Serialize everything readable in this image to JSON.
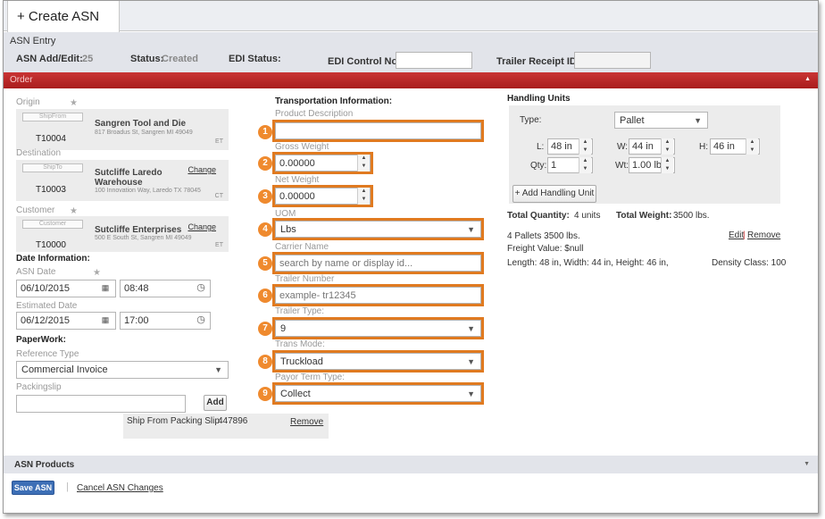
{
  "tab": {
    "icon": "plus-icon",
    "label": "+ Create ASN"
  },
  "section_title": "ASN Entry",
  "header": {
    "asn_label": "ASN Add/Edit:",
    "asn_value": "25",
    "status_label": "Status:",
    "status_value": "Created",
    "edi_status_label": "EDI Status:",
    "edi_control_label": "EDI Control No:",
    "edi_control_value": "",
    "trailer_receipt_label": "Trailer Receipt ID:",
    "trailer_receipt_value": ""
  },
  "order_bar": "Order",
  "origin": {
    "label": "Origin",
    "pill": "ShipFrom",
    "code": "T10004",
    "name": "Sangren Tool and Die",
    "address": "817 Broadus St, Sangren MI 49049",
    "tz": "ET"
  },
  "destination": {
    "label": "Destination",
    "pill": "ShipTo",
    "code": "T10003",
    "name_line1": "Sutcliffe Laredo",
    "name_line2": "Warehouse",
    "address": "100 Innovation Way, Laredo TX 78045",
    "tz": "CT",
    "change": "Change"
  },
  "customer": {
    "label": "Customer",
    "pill": "Customer",
    "code": "T10000",
    "name": "Sutcliffe Enterprises",
    "address": "500 E South St, Sangren MI 49049",
    "tz": "ET",
    "change": "Change"
  },
  "date_info": {
    "title": "Date Information:",
    "asn_date_label": "ASN Date",
    "asn_date": "06/10/2015",
    "asn_time": "08:48",
    "est_date_label": "Estimated Date",
    "est_date": "06/12/2015",
    "est_time": "17:00"
  },
  "paperwork": {
    "title": "PaperWork:",
    "ref_type_label": "Reference Type",
    "ref_type_value": "Commercial Invoice",
    "packingslip_label": "Packingslip",
    "packingslip_value": "",
    "add_label": "Add",
    "slip_row_label": "Ship From Packing Slip",
    "slip_row_value": "447896",
    "slip_row_remove": "Remove"
  },
  "transport": {
    "title": "Transportation Information:",
    "fields": [
      {
        "num": "1",
        "label": "Product Description",
        "value": "",
        "placeholder": ""
      },
      {
        "num": "2",
        "label": "Gross Weight",
        "value": "0.00000"
      },
      {
        "num": "3",
        "label": "Net Weight",
        "value": "0.00000"
      },
      {
        "num": "4",
        "label": "UOM",
        "value": "Lbs"
      },
      {
        "num": "5",
        "label": "Carrier Name",
        "placeholder": "search by name or display id..."
      },
      {
        "num": "6",
        "label": "Trailer Number",
        "placeholder": "example- tr12345"
      },
      {
        "num": "7",
        "label": "Trailer Type:",
        "value": "9"
      },
      {
        "num": "8",
        "label": "Trans Mode:",
        "value": "Truckload"
      },
      {
        "num": "9",
        "label": "Payor Term Type:",
        "value": "Collect"
      }
    ]
  },
  "handling": {
    "title": "Handling Units",
    "type_label": "Type:",
    "type_value": "Pallet",
    "l_label": "L:",
    "l_value": "48 in",
    "w_label": "W:",
    "w_value": "44 in",
    "h_label": "H:",
    "h_value": "46 in",
    "qty_label": "Qty:",
    "qty_value": "1",
    "wt_label": "Wt:",
    "wt_value": "1.00 lb",
    "add_button": "+ Add Handling Unit",
    "total_qty_label": "Total Quantity:",
    "total_qty_value": "4 units",
    "total_wt_label": "Total Weight:",
    "total_wt_value": "3500 lbs.",
    "summary_line": "4 Pallets 3500 lbs.",
    "edit": "Edit",
    "remove": "Remove",
    "freight_value": "Freight Value: $null",
    "dims_line": "Length: 48 in, Width: 44 in, Height: 46 in,",
    "density": "Density Class: 100"
  },
  "products_bar": "ASN Products",
  "footer": {
    "save": "Save ASN",
    "cancel": "Cancel ASN Changes"
  },
  "colors": {
    "accent_red": "#b82525",
    "highlight_orange": "#e07a20",
    "save_blue": "#3d6fb6"
  }
}
